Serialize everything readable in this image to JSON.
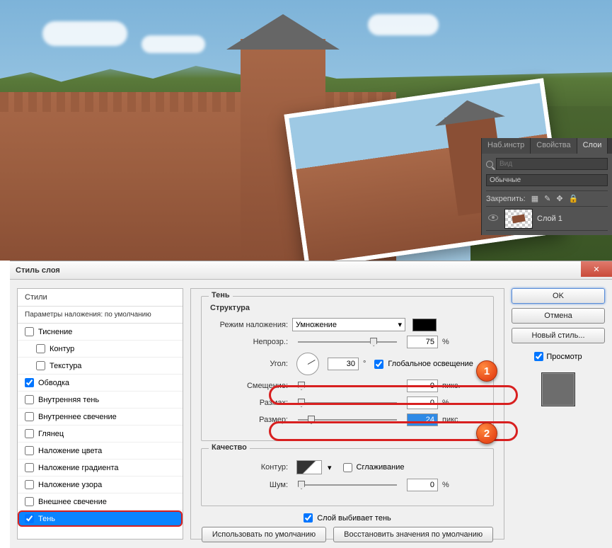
{
  "panels": {
    "tabs": [
      "Наб.инстр",
      "Свойства",
      "Слои"
    ],
    "active_tab": "Слои",
    "search_placeholder": "Вид",
    "blend_mode": "Обычные",
    "lock_label": "Закрепить:",
    "layer_name": "Слой 1"
  },
  "dialog": {
    "title": "Стиль слоя",
    "styles_header": "Стили",
    "styles_sub": "Параметры наложения: по умолчанию",
    "items": [
      {
        "label": "Тиснение",
        "checked": false,
        "indent": false
      },
      {
        "label": "Контур",
        "checked": false,
        "indent": true
      },
      {
        "label": "Текстура",
        "checked": false,
        "indent": true
      },
      {
        "label": "Обводка",
        "checked": true,
        "indent": false
      },
      {
        "label": "Внутренняя тень",
        "checked": false,
        "indent": false
      },
      {
        "label": "Внутреннее свечение",
        "checked": false,
        "indent": false
      },
      {
        "label": "Глянец",
        "checked": false,
        "indent": false
      },
      {
        "label": "Наложение цвета",
        "checked": false,
        "indent": false
      },
      {
        "label": "Наложение градиента",
        "checked": false,
        "indent": false
      },
      {
        "label": "Наложение узора",
        "checked": false,
        "indent": false
      },
      {
        "label": "Внешнее свечение",
        "checked": false,
        "indent": false
      },
      {
        "label": "Тень",
        "checked": true,
        "indent": false,
        "selected": true
      }
    ],
    "section_title": "Тень",
    "structure_title": "Структура",
    "quality_title": "Качество",
    "labels": {
      "blend_mode": "Режим наложения:",
      "opacity": "Непрозр.:",
      "angle": "Угол:",
      "global": "Глобальное освещение",
      "distance": "Смещение:",
      "spread": "Размах:",
      "size": "Размер:",
      "contour": "Контур:",
      "antialias": "Сглаживание",
      "noise": "Шум:",
      "knockout": "Слой выбивает тень",
      "px": "пикс.",
      "pct": "%",
      "deg": "°"
    },
    "values": {
      "blend_mode": "Умножение",
      "opacity": "75",
      "angle": "30",
      "global_checked": true,
      "distance": "0",
      "spread": "0",
      "size": "24",
      "antialias": false,
      "noise": "0",
      "knockout": true
    },
    "buttons": {
      "ok": "OK",
      "cancel": "Отмена",
      "new_style": "Новый стиль...",
      "preview": "Просмотр",
      "use_default": "Использовать по умолчанию",
      "reset_default": "Восстановить значения по умолчанию"
    },
    "callouts": {
      "one": "1",
      "two": "2"
    }
  }
}
